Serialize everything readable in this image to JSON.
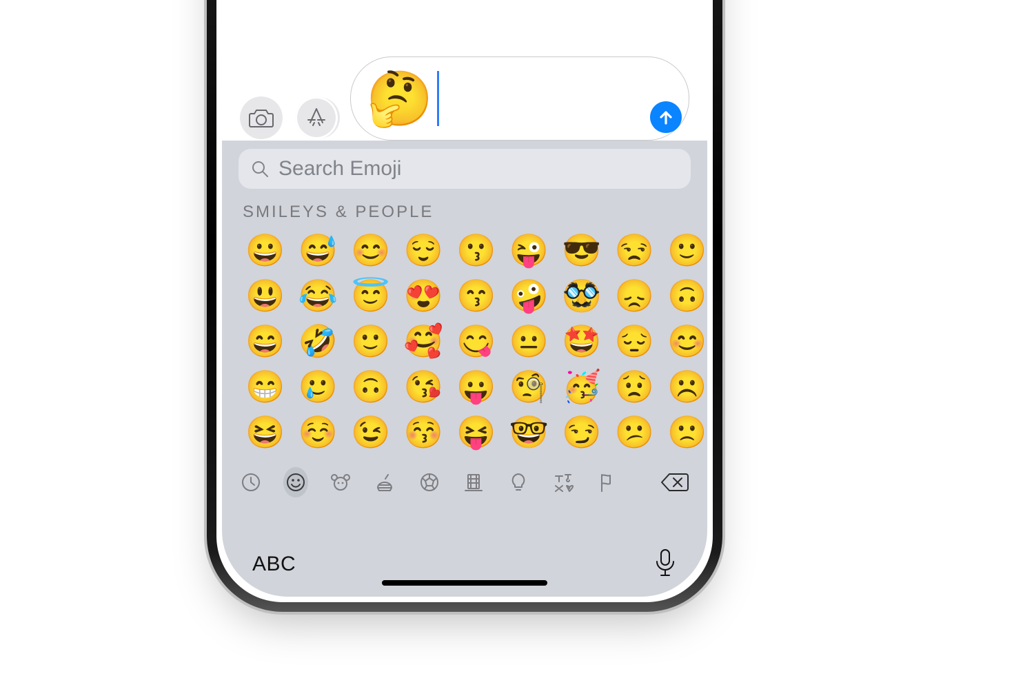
{
  "compose": {
    "typed_emoji": "🤔"
  },
  "keyboard": {
    "search_placeholder": "Search Emoji",
    "section_label": "SMILEYS & PEOPLE",
    "emoji_rows": [
      [
        "😀",
        "😅",
        "😊",
        "😌",
        "😗",
        "😜",
        "😎",
        "😒",
        "🙂"
      ],
      [
        "😃",
        "😂",
        "😇",
        "😍",
        "😙",
        "🤪",
        "🥸",
        "😞",
        "🙃"
      ],
      [
        "😄",
        "🤣",
        "🙂",
        "🥰",
        "😋",
        "😐",
        "🤩",
        "😔",
        "😊"
      ],
      [
        "😁",
        "🥲",
        "🙃",
        "😘",
        "😛",
        "🧐",
        "🥳",
        "😟",
        "☹️"
      ],
      [
        "😆",
        "☺️",
        "😉",
        "😚",
        "😝",
        "🤓",
        "😏",
        "😕",
        "🙁"
      ]
    ],
    "categories": [
      {
        "name": "recents-icon",
        "selected": false
      },
      {
        "name": "smileys-icon",
        "selected": true
      },
      {
        "name": "animals-icon",
        "selected": false
      },
      {
        "name": "food-icon",
        "selected": false
      },
      {
        "name": "activity-icon",
        "selected": false
      },
      {
        "name": "travel-icon",
        "selected": false
      },
      {
        "name": "objects-icon",
        "selected": false
      },
      {
        "name": "symbols-icon",
        "selected": false
      },
      {
        "name": "flags-icon",
        "selected": false
      }
    ],
    "abc_label": "ABC"
  }
}
